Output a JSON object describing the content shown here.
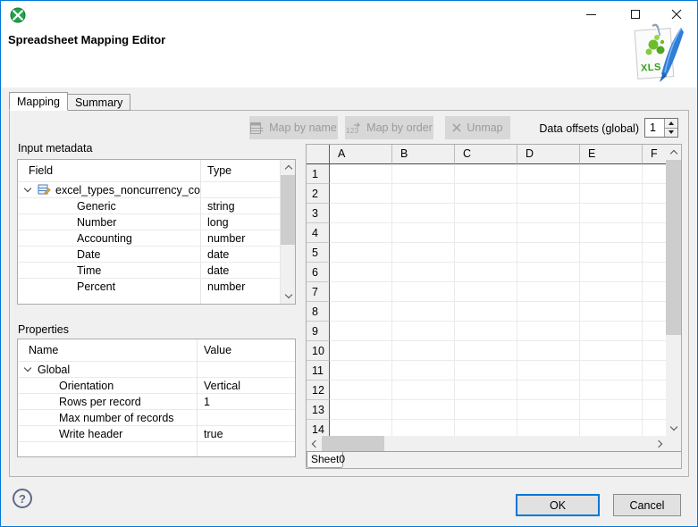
{
  "window": {
    "dialog_title": "Spreadsheet Mapping Editor"
  },
  "header": {
    "xls_icon_label": "XLS"
  },
  "tabs": {
    "mapping": "Mapping",
    "summary": "Summary"
  },
  "toolbar": {
    "map_by_name": "Map by name",
    "map_by_order": "Map by order",
    "unmap": "Unmap",
    "data_offsets_label": "Data offsets (global)",
    "data_offsets_value": "1"
  },
  "icons": {
    "map_by_order_digits": "123"
  },
  "input_metadata": {
    "section_label": "Input metadata",
    "columns": [
      "Field",
      "Type"
    ],
    "root_field": "excel_types_noncurrency_con",
    "fields": [
      {
        "name": "Generic",
        "type": "string"
      },
      {
        "name": "Number",
        "type": "long"
      },
      {
        "name": "Accounting",
        "type": "number"
      },
      {
        "name": "Date",
        "type": "date"
      },
      {
        "name": "Time",
        "type": "date"
      },
      {
        "name": "Percent",
        "type": "number"
      }
    ]
  },
  "properties": {
    "section_label": "Properties",
    "columns": [
      "Name",
      "Value"
    ],
    "root_group": "Global",
    "rows": [
      {
        "name": "Orientation",
        "value": "Vertical"
      },
      {
        "name": "Rows per record",
        "value": "1"
      },
      {
        "name": "Max number of records",
        "value": ""
      },
      {
        "name": "Write header",
        "value": "true"
      }
    ],
    "empty_rows": 2
  },
  "spreadsheet": {
    "column_headers": [
      "A",
      "B",
      "C",
      "D",
      "E",
      "F"
    ],
    "row_headers": [
      "1",
      "2",
      "3",
      "4",
      "5",
      "6",
      "7",
      "8",
      "9",
      "10",
      "11",
      "12",
      "13",
      "14"
    ],
    "sheet_tab": "Sheet0"
  },
  "footer": {
    "help": "?",
    "ok": "OK",
    "cancel": "Cancel"
  },
  "colors": {
    "accent": "#0078d7",
    "dialog_bg": "#f0f0f0",
    "header_bg": "#ffffff",
    "disabled_button_bg": "#d8d8d8",
    "disabled_button_text": "#9b9b9b",
    "grid_header_bg": "#f0f0f0",
    "grid_line": "#ebebeb",
    "grid_header_border": "#4a4a4a",
    "table_border": "#ababab",
    "scroll_thumb": "#cdcdcd",
    "help_icon": "#5d6a85",
    "clover_green": "#21a24b"
  }
}
